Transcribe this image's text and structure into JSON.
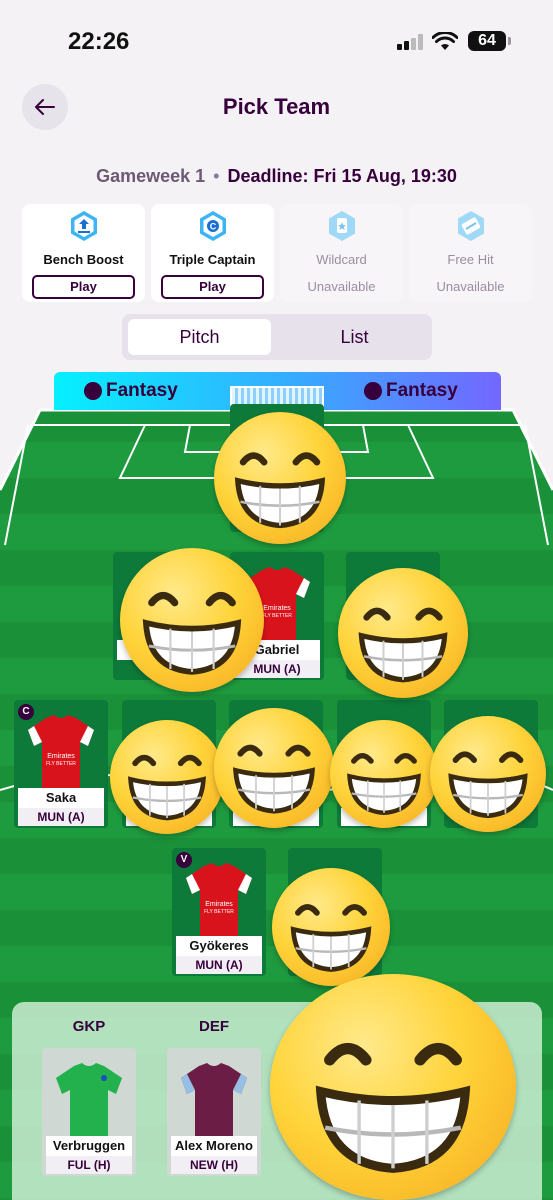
{
  "status_bar": {
    "time": "22:26",
    "battery": "64"
  },
  "header": {
    "title": "Pick Team"
  },
  "gameweek": {
    "label": "Gameweek 1",
    "separator": "•",
    "deadline": "Deadline: Fri 15 Aug, 19:30"
  },
  "chips": [
    {
      "name": "Bench Boost",
      "action": "Play"
    },
    {
      "name": "Triple Captain",
      "action": "Play"
    },
    {
      "name": "Wildcard",
      "status": "Unavailable"
    },
    {
      "name": "Free Hit",
      "status": "Unavailable"
    }
  ],
  "view_toggle": {
    "pitch": "Pitch",
    "list": "List",
    "selected": "Pitch"
  },
  "banner": {
    "left": "Fantasy",
    "right": "Fantasy"
  },
  "pitch": {
    "defenders": [
      {
        "name": "B",
        "fixture": ""
      },
      {
        "name": "Gabriel",
        "fixture": "MUN (A)"
      }
    ],
    "midfielders": [
      {
        "name": "Saka",
        "fixture": "MUN (A)",
        "badge": "C"
      }
    ],
    "forwards": [
      {
        "name": "Gyökeres",
        "fixture": "MUN (A)",
        "badge": "V"
      }
    ]
  },
  "bench": {
    "labels": [
      "GKP",
      "DEF"
    ],
    "players": [
      {
        "name": "Verbruggen",
        "fixture": "FUL (H)"
      },
      {
        "name": "Alex Moreno",
        "fixture": "NEW (H)"
      }
    ]
  },
  "colors": {
    "brand": "#37003c",
    "pitch": "#1f9b3f",
    "arsenal": "#d9131b",
    "brighton_gk": "#22b14c",
    "villa": "#6c1d45"
  }
}
